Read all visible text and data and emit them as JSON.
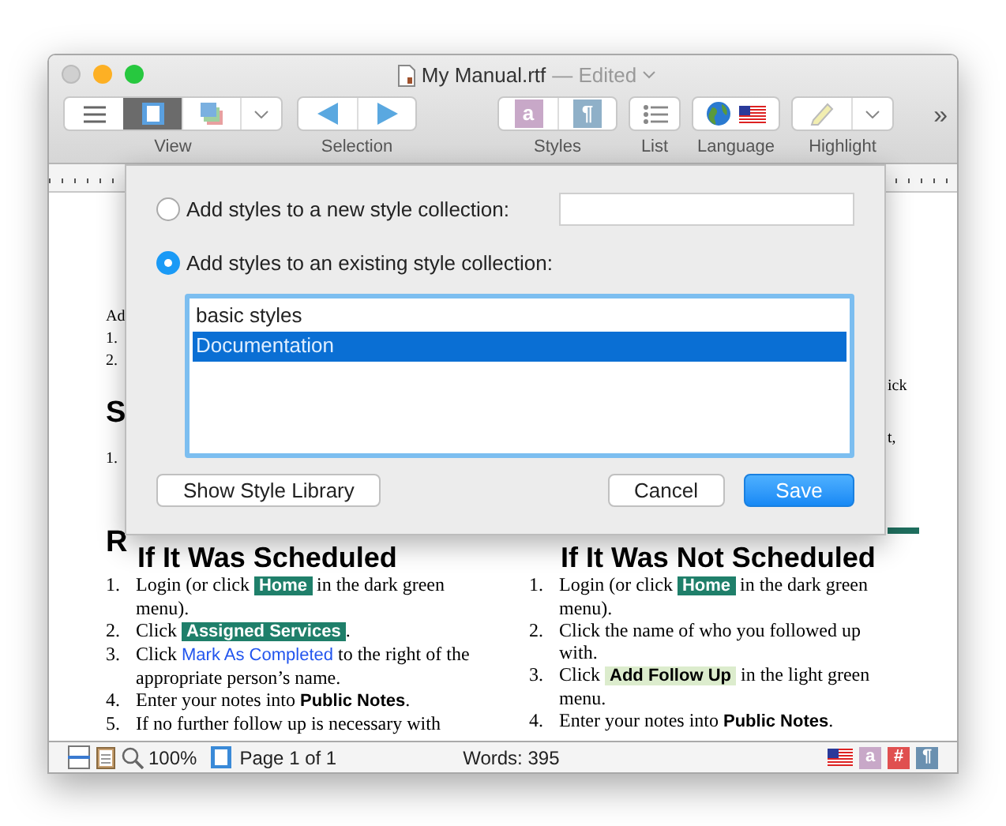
{
  "window": {
    "title": "My Manual.rtf",
    "status": "— Edited"
  },
  "toolbar": {
    "groups": [
      {
        "kind": "view",
        "label": "View"
      },
      {
        "kind": "selection",
        "label": "Selection"
      },
      {
        "kind": "styles",
        "label": "Styles",
        "glyphs": [
          "a",
          "¶"
        ]
      },
      {
        "kind": "list",
        "label": "List"
      },
      {
        "kind": "language",
        "label": "Language"
      },
      {
        "kind": "highlight",
        "label": "Highlight"
      }
    ],
    "overflow": "»"
  },
  "document": {
    "left_fragments": [
      {
        "kind": "text",
        "text": "Ad"
      },
      {
        "kind": "text",
        "text": "1."
      },
      {
        "kind": "text",
        "text": "2."
      },
      {
        "kind": "heading",
        "text": "S"
      },
      {
        "kind": "text",
        "text": "1."
      },
      {
        "kind": "heading",
        "text": "R"
      }
    ],
    "right_fragments": [
      {
        "kind": "text",
        "text": "ick"
      },
      {
        "kind": "text",
        "text": "t,"
      }
    ],
    "columns": [
      {
        "heading": "If It Was Scheduled",
        "items": [
          {
            "number": "1.",
            "segments": [
              {
                "kind": "plain",
                "text": "Login (or click "
              },
              {
                "kind": "dark",
                "text": "Home"
              },
              {
                "kind": "plain",
                "text": " in the dark green menu)."
              }
            ]
          },
          {
            "number": "2.",
            "segments": [
              {
                "kind": "plain",
                "text": "Click "
              },
              {
                "kind": "dark",
                "text": "Assigned Services"
              },
              {
                "kind": "plain",
                "text": "."
              }
            ]
          },
          {
            "number": "3.",
            "segments": [
              {
                "kind": "plain",
                "text": "Click "
              },
              {
                "kind": "link",
                "text": "Mark As Completed"
              },
              {
                "kind": "plain",
                "text": " to the right of the appropriate person’s name."
              }
            ]
          },
          {
            "number": "4.",
            "segments": [
              {
                "kind": "plain",
                "text": "Enter your notes into "
              },
              {
                "kind": "bold",
                "text": "Public Notes"
              },
              {
                "kind": "plain",
                "text": "."
              }
            ]
          },
          {
            "number": "5.",
            "segments": [
              {
                "kind": "plain",
                "text": "If no further follow up is necessary with"
              }
            ]
          }
        ]
      },
      {
        "heading": "If It Was Not Scheduled",
        "items": [
          {
            "number": "1.",
            "segments": [
              {
                "kind": "plain",
                "text": "Login (or click "
              },
              {
                "kind": "dark",
                "text": "Home"
              },
              {
                "kind": "plain",
                "text": " in the dark green menu)."
              }
            ]
          },
          {
            "number": "2.",
            "segments": [
              {
                "kind": "plain",
                "text": "Click the name of who you followed up with."
              }
            ]
          },
          {
            "number": "3.",
            "segments": [
              {
                "kind": "plain",
                "text": "Click "
              },
              {
                "kind": "light",
                "text": "Add Follow Up"
              },
              {
                "kind": "plain",
                "text": " in the light green menu."
              }
            ]
          },
          {
            "number": "4.",
            "segments": [
              {
                "kind": "plain",
                "text": "Enter your notes into "
              },
              {
                "kind": "bold",
                "text": "Public Notes"
              },
              {
                "kind": "plain",
                "text": "."
              }
            ]
          }
        ]
      }
    ]
  },
  "dialog": {
    "options": [
      {
        "label": "Add styles to a new style collection:",
        "selected": false
      },
      {
        "label": "Add styles to an existing style collection:",
        "selected": true
      }
    ],
    "collections": [
      {
        "name": "basic styles",
        "selected": false
      },
      {
        "name": "Documentation",
        "selected": true
      }
    ],
    "buttons": [
      {
        "kind": "secondary",
        "label": "Show Style Library"
      },
      {
        "kind": "secondary",
        "label": "Cancel"
      },
      {
        "kind": "primary",
        "label": "Save"
      }
    ]
  },
  "status_bar": {
    "zoom": "100%",
    "page": "Page 1 of 1",
    "words": "Words: 395",
    "glyphs": [
      "a",
      "#",
      "¶"
    ]
  }
}
